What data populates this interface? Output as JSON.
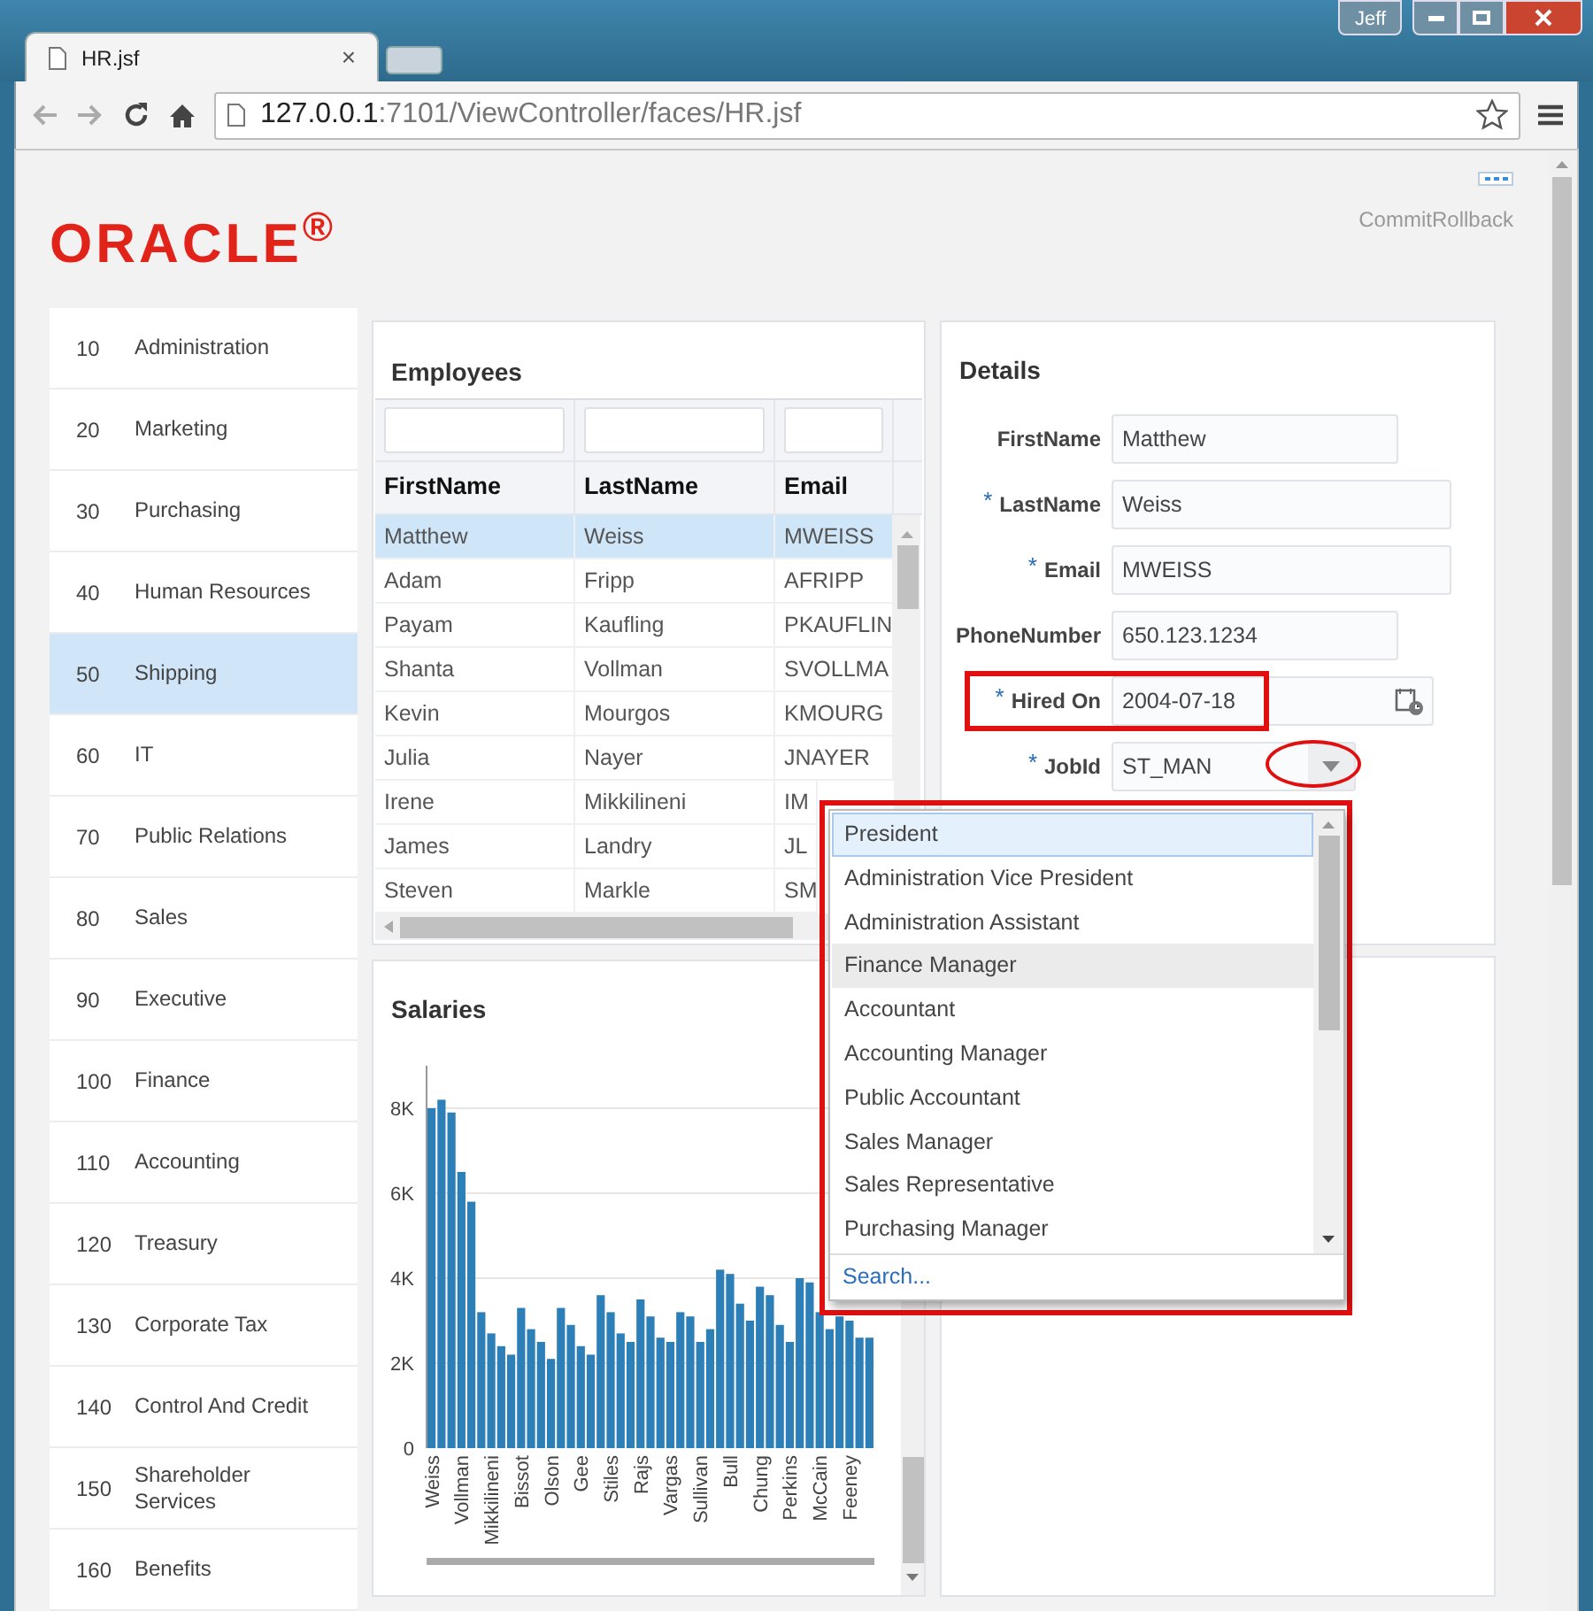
{
  "browser": {
    "tab": {
      "title": "HR.jsf",
      "close": "×"
    },
    "profile": "Jeff",
    "address": {
      "host": "127.0.0.1",
      "path": ":7101/ViewController/faces/HR.jsf"
    }
  },
  "header": {
    "logo": "ORACLE$^{®}$",
    "actions": "CommitRollback"
  },
  "departments": [
    {
      "number": "10",
      "name": "Administration",
      "selected": false
    },
    {
      "number": "20",
      "name": "Marketing",
      "selected": false
    },
    {
      "number": "30",
      "name": "Purchasing",
      "selected": false
    },
    {
      "number": "40",
      "name": "Human Resources",
      "selected": false
    },
    {
      "number": "50",
      "name": "Shipping",
      "selected": true
    },
    {
      "number": "60",
      "name": "IT",
      "selected": false
    },
    {
      "number": "70",
      "name": "Public Relations",
      "selected": false
    },
    {
      "number": "80",
      "name": "Sales",
      "selected": false
    },
    {
      "number": "90",
      "name": "Executive",
      "selected": false
    },
    {
      "number": "100",
      "name": "Finance",
      "selected": false
    },
    {
      "number": "110",
      "name": "Accounting",
      "selected": false
    },
    {
      "number": "120",
      "name": "Treasury",
      "selected": false
    },
    {
      "number": "130",
      "name": "Corporate Tax",
      "selected": false
    },
    {
      "number": "140",
      "name": "Control And Credit",
      "selected": false
    },
    {
      "number": "150",
      "name": "Shareholder Services",
      "selected": false
    },
    {
      "number": "160",
      "name": "Benefits",
      "selected": false
    }
  ],
  "employees": {
    "title": "Employees",
    "columns": [
      "FirstName",
      "LastName",
      "Email"
    ],
    "rows": [
      {
        "cells": [
          "Matthew",
          "Weiss",
          "MWEISS"
        ],
        "selected": true
      },
      {
        "cells": [
          "Adam",
          "Fripp",
          "AFRIPP"
        ],
        "selected": false
      },
      {
        "cells": [
          "Payam",
          "Kaufling",
          "PKAUFLIN"
        ],
        "selected": false
      },
      {
        "cells": [
          "Shanta",
          "Vollman",
          "SVOLLMA"
        ],
        "selected": false
      },
      {
        "cells": [
          "Kevin",
          "Mourgos",
          "KMOURG"
        ],
        "selected": false
      },
      {
        "cells": [
          "Julia",
          "Nayer",
          "JNAYER"
        ],
        "selected": false
      },
      {
        "cells": [
          "Irene",
          "Mikkilineni",
          "IM"
        ],
        "selected": false
      },
      {
        "cells": [
          "James",
          "Landry",
          "JL"
        ],
        "selected": false
      },
      {
        "cells": [
          "Steven",
          "Markle",
          "SM"
        ],
        "selected": false
      }
    ]
  },
  "details": {
    "title": "Details",
    "fields": [
      {
        "kind": "text",
        "label": "FirstName",
        "value": "Matthew",
        "outlined": false
      },
      {
        "kind": "text",
        "label": "LastName",
        "value": "Weiss",
        "required_mark": "*",
        "outlined": false
      },
      {
        "kind": "text",
        "label": "Email",
        "value": "MWEISS",
        "required_mark": "*",
        "outlined": false
      },
      {
        "kind": "text",
        "label": "PhoneNumber",
        "value": "650.123.1234",
        "outlined": false
      },
      {
        "kind": "date",
        "label": "Hired On",
        "value": "2004-07-18",
        "required_mark": "*",
        "outlined": true
      },
      {
        "kind": "select",
        "label": "JobId",
        "value": "ST_MAN",
        "required_mark": "*",
        "outlined": false,
        "button_circled": true
      }
    ]
  },
  "job_list": {
    "outlined": true,
    "items": [
      {
        "label": "President",
        "selected": true,
        "hovered": false
      },
      {
        "label": "Administration Vice President",
        "selected": false,
        "hovered": false
      },
      {
        "label": "Administration Assistant",
        "selected": false,
        "hovered": false
      },
      {
        "label": "Finance Manager",
        "selected": false,
        "hovered": true
      },
      {
        "label": "Accountant",
        "selected": false,
        "hovered": false
      },
      {
        "label": "Accounting Manager",
        "selected": false,
        "hovered": false
      },
      {
        "label": "Public Accountant",
        "selected": false,
        "hovered": false
      },
      {
        "label": "Sales Manager",
        "selected": false,
        "hovered": false
      },
      {
        "label": "Sales Representative",
        "selected": false,
        "hovered": false
      },
      {
        "label": "Purchasing Manager",
        "selected": false,
        "hovered": false
      }
    ],
    "search": "Search..."
  },
  "salaries": {
    "title": "Salaries",
    "chart_data": {
      "type": "bar",
      "categories": [
        "Weiss",
        null,
        null,
        "Vollman",
        null,
        null,
        "Mikkilineni",
        null,
        null,
        "Bissot",
        null,
        null,
        "Olson",
        null,
        null,
        "Gee",
        null,
        null,
        "Stiles",
        null,
        null,
        "Rajs",
        null,
        null,
        "Vargas",
        null,
        null,
        "Sullivan",
        null,
        null,
        "Bull",
        null,
        null,
        "Chung",
        null,
        null,
        "Perkins",
        null,
        null,
        "McCain",
        null,
        null,
        "Feeney",
        null,
        null
      ],
      "series": [
        {
          "color": "#2d7fb8",
          "values": [
            8000,
            8200,
            7900,
            6500,
            5800,
            3200,
            2700,
            2400,
            2200,
            3300,
            2800,
            2500,
            2100,
            3300,
            2900,
            2400,
            2200,
            3600,
            3200,
            2700,
            2500,
            3500,
            3100,
            2600,
            2500,
            3200,
            3100,
            2500,
            2800,
            4200,
            4100,
            3400,
            3000,
            3800,
            3600,
            2900,
            2500,
            4000,
            3900,
            3200,
            2800,
            3100,
            3000,
            2600,
            2600
          ]
        }
      ],
      "ylim": [
        0,
        9000
      ],
      "grid": true,
      "yticks": [
        {
          "value": 0,
          "label": "0"
        },
        {
          "value": 2000,
          "label": "2K"
        },
        {
          "value": 4000,
          "label": "4K"
        },
        {
          "value": 6000,
          "label": "6K"
        },
        {
          "value": 8000,
          "label": "8K"
        }
      ]
    }
  }
}
